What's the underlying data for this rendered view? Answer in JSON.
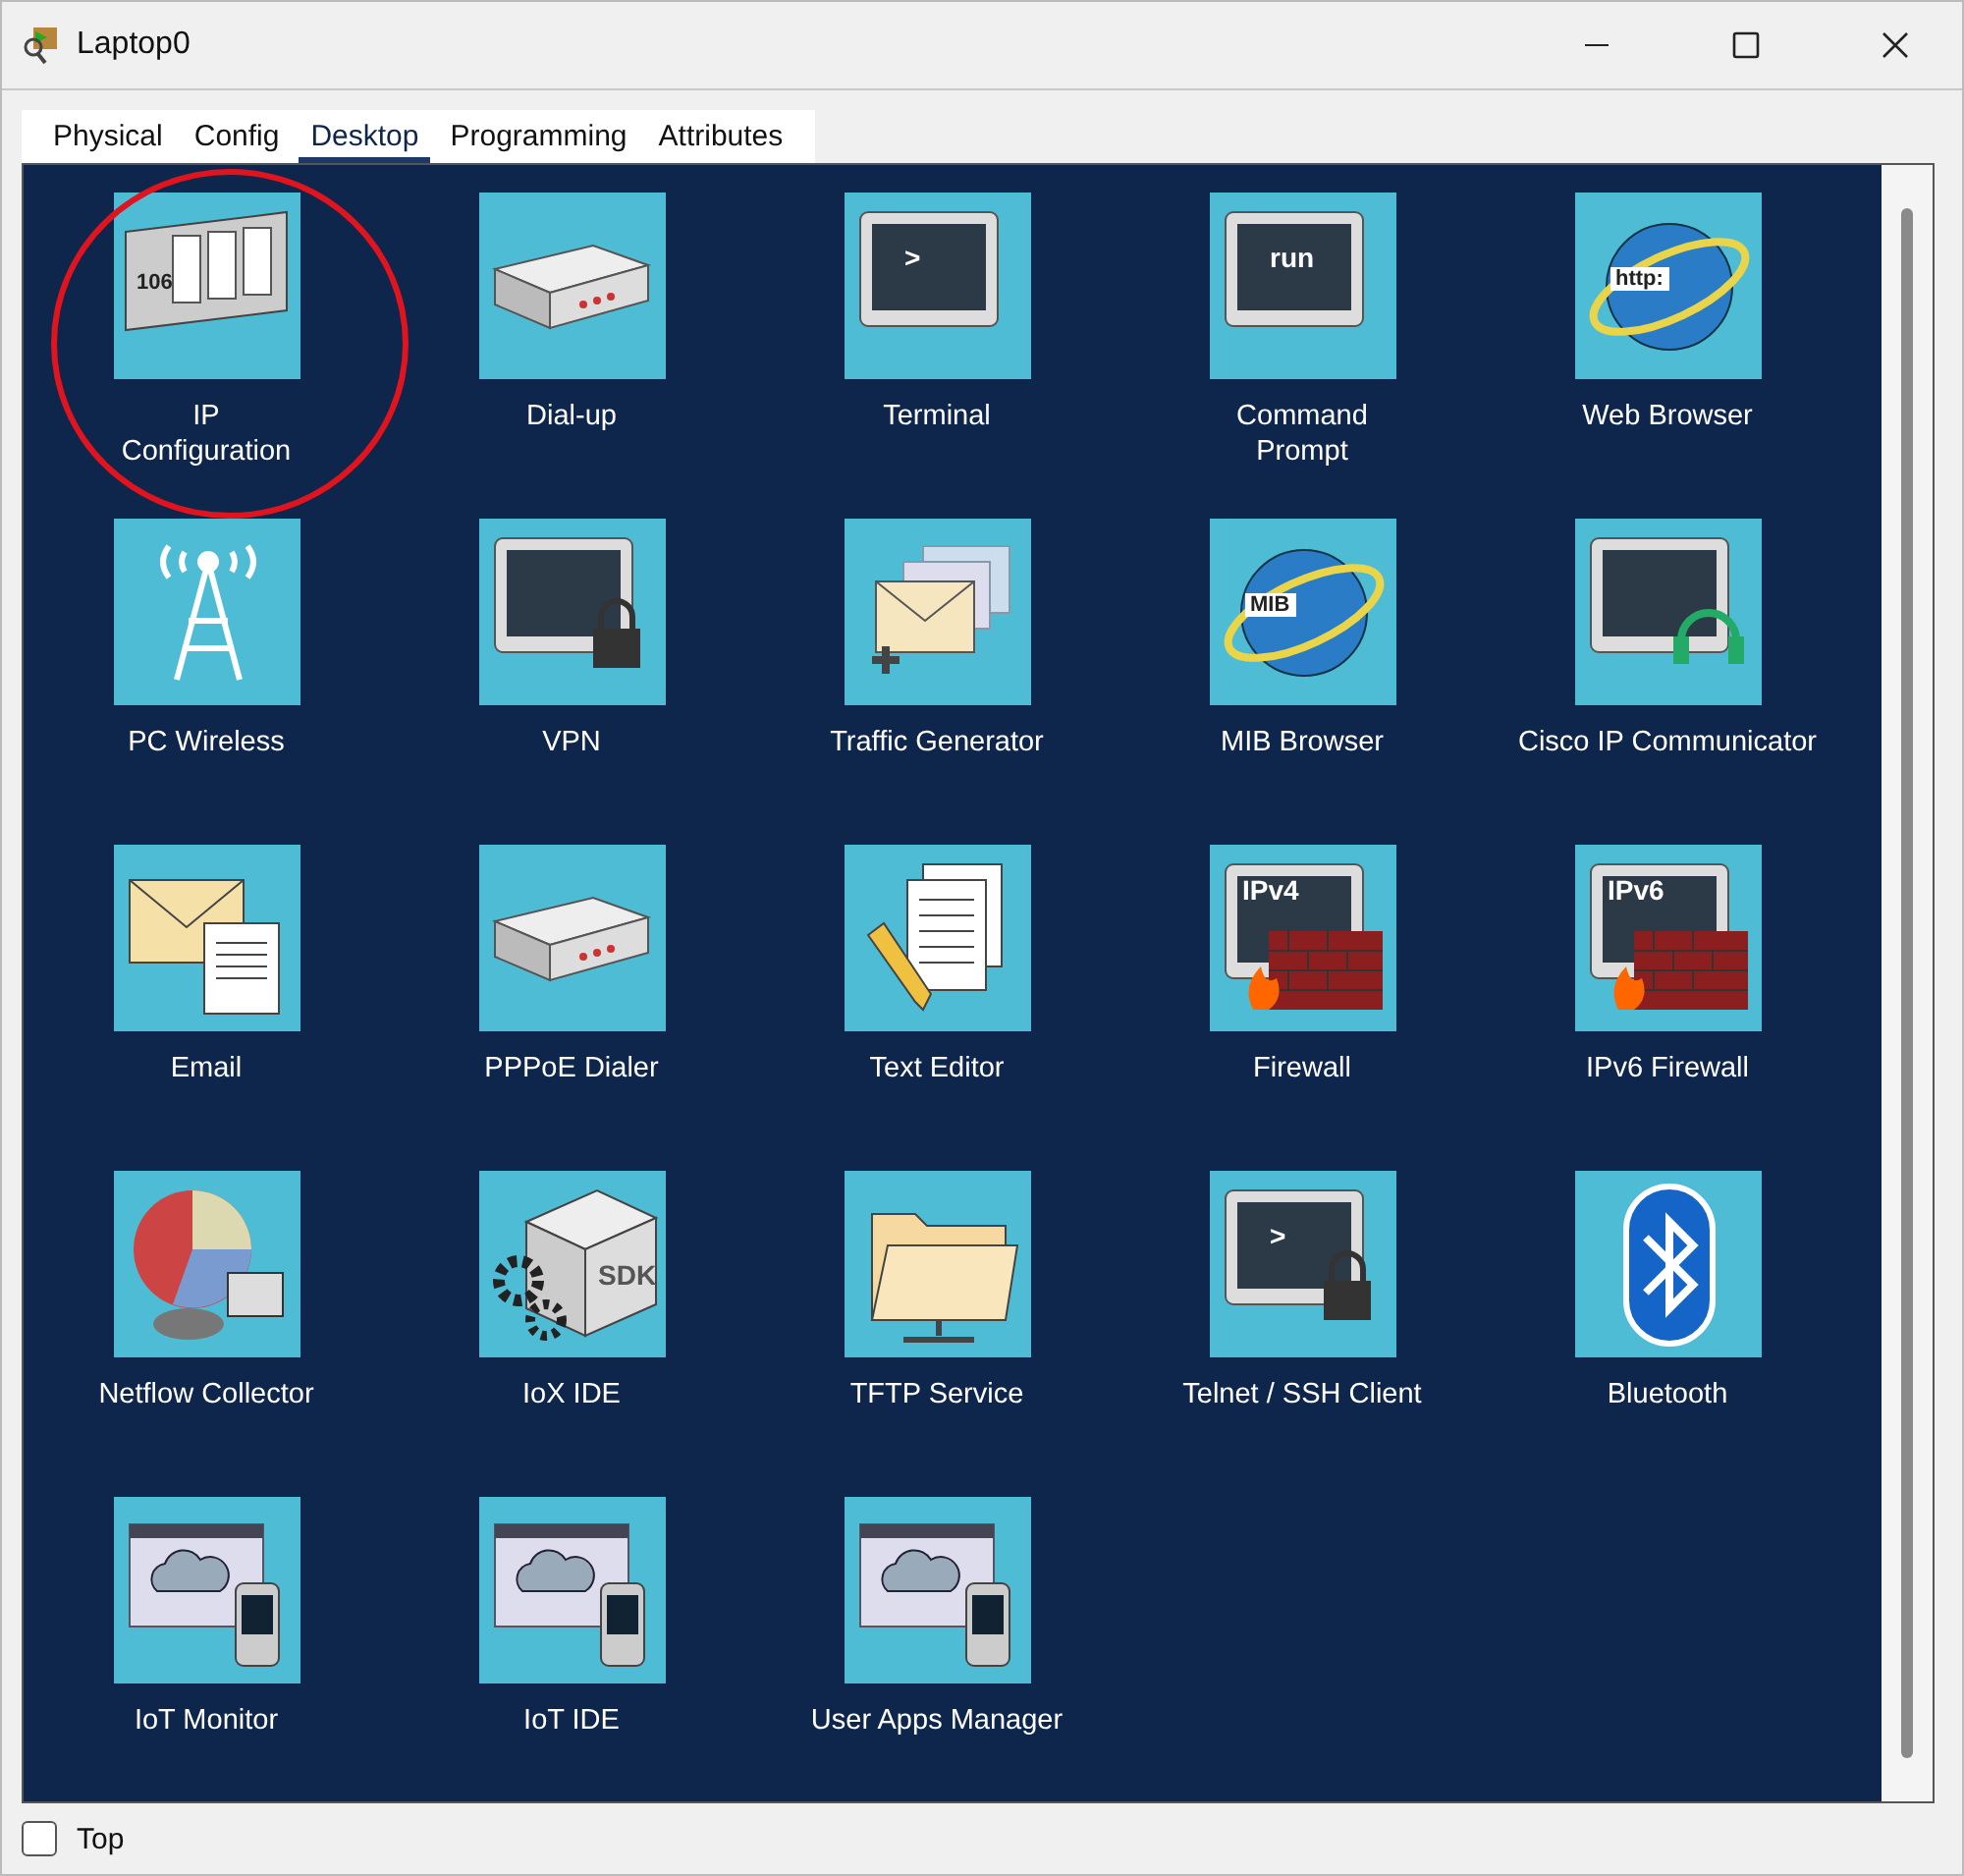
{
  "window": {
    "title": "Laptop0"
  },
  "tabs": [
    {
      "label": "Physical",
      "selected": false
    },
    {
      "label": "Config",
      "selected": false
    },
    {
      "label": "Desktop",
      "selected": true
    },
    {
      "label": "Programming",
      "selected": false
    },
    {
      "label": "Attributes",
      "selected": false
    }
  ],
  "apps": [
    {
      "label": "IP\nConfiguration",
      "kind": "ipconfig",
      "icon_text": "106",
      "circled": true
    },
    {
      "label": "Dial-up",
      "kind": "modem",
      "circled": false
    },
    {
      "label": "Terminal",
      "kind": "terminal",
      "icon_text": ">",
      "circled": false
    },
    {
      "label": "Command\nPrompt",
      "kind": "terminal",
      "icon_text": "run",
      "circled": false
    },
    {
      "label": "Web Browser",
      "kind": "globe",
      "icon_text": "http:",
      "circled": false
    },
    {
      "label": "PC Wireless",
      "kind": "tower",
      "circled": false
    },
    {
      "label": "VPN",
      "kind": "lockmonitor",
      "circled": false
    },
    {
      "label": "Traffic Generator",
      "kind": "envelopes",
      "circled": false
    },
    {
      "label": "MIB Browser",
      "kind": "globe",
      "icon_text": "MIB",
      "circled": false
    },
    {
      "label": "Cisco IP Communicator",
      "kind": "headset",
      "circled": false
    },
    {
      "label": "Email",
      "kind": "email",
      "circled": false
    },
    {
      "label": "PPPoE Dialer",
      "kind": "modem",
      "circled": false
    },
    {
      "label": "Text Editor",
      "kind": "editor",
      "circled": false
    },
    {
      "label": "Firewall",
      "kind": "firewall",
      "icon_text": "IPv4",
      "circled": false
    },
    {
      "label": "IPv6 Firewall",
      "kind": "firewall",
      "icon_text": "IPv6",
      "circled": false
    },
    {
      "label": "Netflow Collector",
      "kind": "pie",
      "circled": false
    },
    {
      "label": "IoX IDE",
      "kind": "sdk",
      "icon_text": "SDK",
      "circled": false
    },
    {
      "label": "TFTP Service",
      "kind": "folder",
      "circled": false
    },
    {
      "label": "Telnet / SSH Client",
      "kind": "lockmonitor",
      "icon_text": ">",
      "circled": false
    },
    {
      "label": "Bluetooth",
      "kind": "bluetooth",
      "circled": false
    },
    {
      "label": "IoT Monitor",
      "kind": "cloudapp",
      "circled": false
    },
    {
      "label": "IoT IDE",
      "kind": "cloudapp",
      "circled": false
    },
    {
      "label": "User Apps Manager",
      "kind": "cloudapp",
      "circled": false
    }
  ],
  "top_checkbox": {
    "label": "Top",
    "checked": false
  }
}
